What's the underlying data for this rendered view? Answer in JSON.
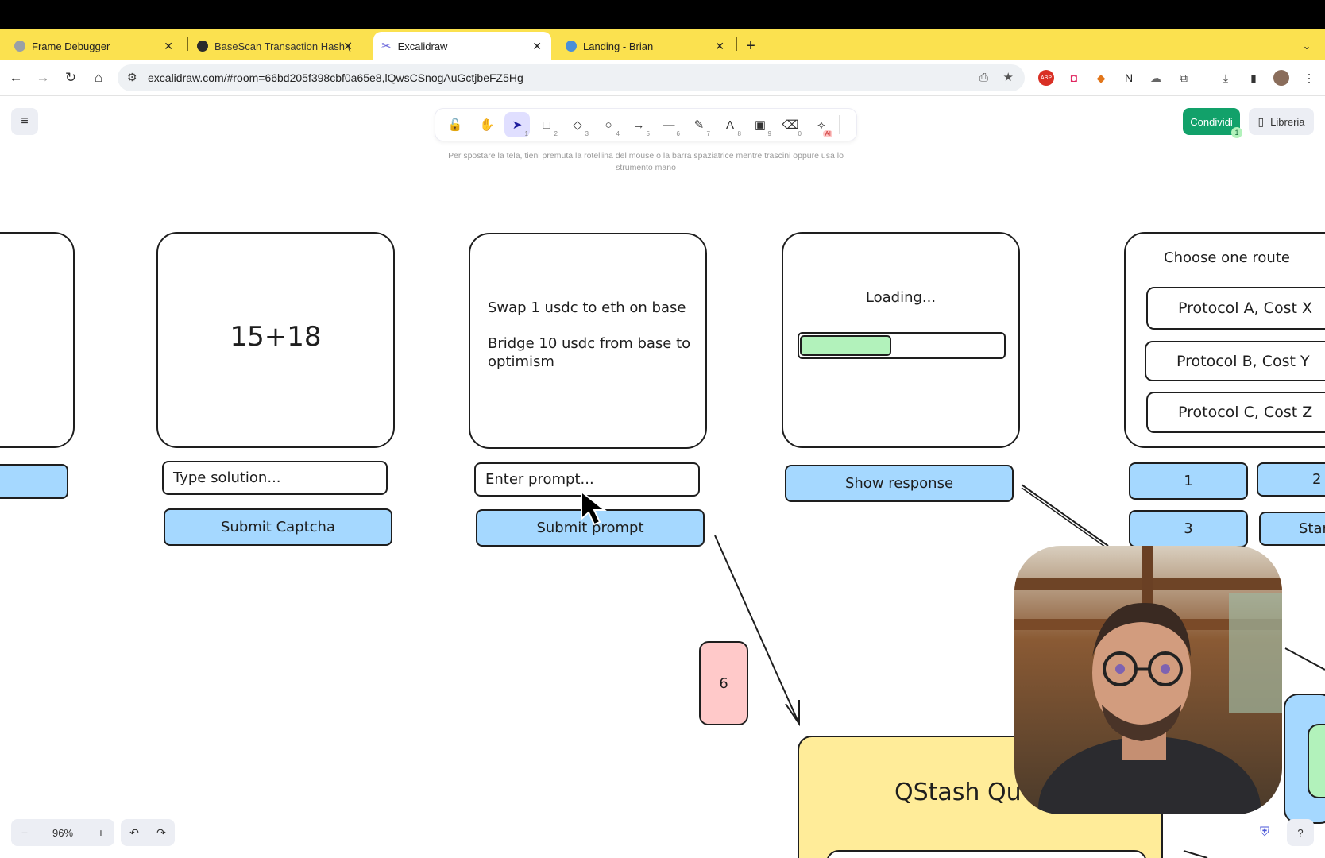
{
  "browser": {
    "tabs": [
      {
        "title": "Frame Debugger",
        "active": false
      },
      {
        "title": "BaseScan Transaction Hash (",
        "active": false
      },
      {
        "title": "Excalidraw",
        "active": true
      },
      {
        "title": "Landing - Brian",
        "active": false
      }
    ],
    "new_tab_label": "+",
    "url": "excalidraw.com/#room=66bd205f398cbf0a65e8,lQwsCSnogAuGctjbeFZ5Hg"
  },
  "app": {
    "share_label": "Condividi",
    "share_count": "1",
    "library_label": "Libreria",
    "tool_hint": "Per spostare la tela, tieni premuta la rotellina del mouse o la barra spaziatrice mentre trascini oppure usa lo strumento mano",
    "tools": [
      {
        "name": "lock-icon",
        "glyph": "🔓",
        "key": ""
      },
      {
        "name": "hand-icon",
        "glyph": "✋",
        "key": ""
      },
      {
        "name": "selection-icon",
        "glyph": "➤",
        "key": "1"
      },
      {
        "name": "rectangle-icon",
        "glyph": "□",
        "key": "2"
      },
      {
        "name": "diamond-icon",
        "glyph": "◇",
        "key": "3"
      },
      {
        "name": "ellipse-icon",
        "glyph": "○",
        "key": "4"
      },
      {
        "name": "arrow-icon",
        "glyph": "→",
        "key": "5"
      },
      {
        "name": "line-icon",
        "glyph": "—",
        "key": "6"
      },
      {
        "name": "pencil-icon",
        "glyph": "✎",
        "key": "7"
      },
      {
        "name": "text-icon",
        "glyph": "A",
        "key": "8"
      },
      {
        "name": "image-icon",
        "glyph": "▣",
        "key": "9"
      },
      {
        "name": "eraser-icon",
        "glyph": "⌫",
        "key": "0"
      },
      {
        "name": "ai-shapes-icon",
        "glyph": "⟡",
        "key": "AI"
      }
    ],
    "zoom": "96%",
    "zoom_out": "−",
    "zoom_in": "+",
    "undo": "↶",
    "redo": "↷"
  },
  "canvas": {
    "captcha": {
      "expression": "15+18",
      "input_placeholder": "Type solution...",
      "button": "Submit Captcha"
    },
    "prompt": {
      "line1": "Swap 1 usdc to eth on base",
      "line2": "Bridge 10 usdc from base to optimism",
      "input_placeholder": "Enter prompt...",
      "button": "Submit prompt"
    },
    "loading": {
      "label": "Loading...",
      "progress": 0.45,
      "button": "Show response"
    },
    "routes": {
      "title": "Choose one route",
      "options": [
        "Protocol A, Cost X",
        "Protocol B, Cost Y",
        "Protocol C, Cost Z"
      ],
      "buttons": [
        "1",
        "2",
        "3",
        "Start"
      ]
    },
    "frame_count": "6",
    "qstash_label": "QStash Qu"
  },
  "colors": {
    "tab_bar": "#fbe14f",
    "button_blue": "#a5d8ff",
    "progress_green": "#b2f2bb",
    "note_pink": "#ffc9c9",
    "qstash_yellow": "#ffec99",
    "share_green": "#12a16a"
  }
}
